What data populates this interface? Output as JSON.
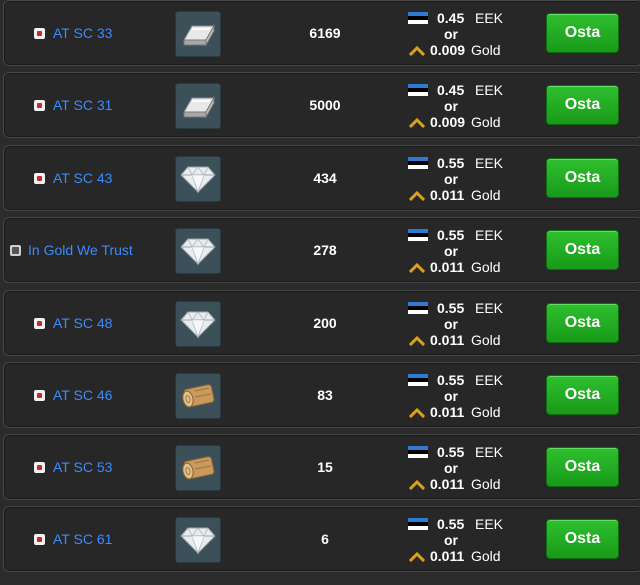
{
  "colors": {
    "link": "#3b8bff",
    "buy_button": "#22aa22",
    "row_bg": "#262726"
  },
  "rows": [
    {
      "seller": "AT SC 33",
      "seller_icon": "flag-icon",
      "item_icon": "silver-bar-icon",
      "quantity": "6169",
      "price_eek": "0.45",
      "currency": "EEK",
      "or_text": "or",
      "price_gold": "0.009",
      "gold_label": "Gold",
      "button": "Osta"
    },
    {
      "seller": "AT SC 31",
      "seller_icon": "flag-icon",
      "item_icon": "silver-bar-icon",
      "quantity": "5000",
      "price_eek": "0.45",
      "currency": "EEK",
      "or_text": "or",
      "price_gold": "0.009",
      "gold_label": "Gold",
      "button": "Osta"
    },
    {
      "seller": "AT SC 43",
      "seller_icon": "flag-icon",
      "item_icon": "diamond-icon",
      "quantity": "434",
      "price_eek": "0.55",
      "currency": "EEK",
      "or_text": "or",
      "price_gold": "0.011",
      "gold_label": "Gold",
      "button": "Osta"
    },
    {
      "seller": "In Gold We Trust",
      "seller_icon": "avatar-icon",
      "item_icon": "diamond-icon",
      "quantity": "278",
      "price_eek": "0.55",
      "currency": "EEK",
      "or_text": "or",
      "price_gold": "0.011",
      "gold_label": "Gold",
      "button": "Osta"
    },
    {
      "seller": "AT SC 48",
      "seller_icon": "flag-icon",
      "item_icon": "diamond-icon",
      "quantity": "200",
      "price_eek": "0.55",
      "currency": "EEK",
      "or_text": "or",
      "price_gold": "0.011",
      "gold_label": "Gold",
      "button": "Osta"
    },
    {
      "seller": "AT SC 46",
      "seller_icon": "flag-icon",
      "item_icon": "wood-log-icon",
      "quantity": "83",
      "price_eek": "0.55",
      "currency": "EEK",
      "or_text": "or",
      "price_gold": "0.011",
      "gold_label": "Gold",
      "button": "Osta"
    },
    {
      "seller": "AT SC 53",
      "seller_icon": "flag-icon",
      "item_icon": "wood-log-icon",
      "quantity": "15",
      "price_eek": "0.55",
      "currency": "EEK",
      "or_text": "or",
      "price_gold": "0.011",
      "gold_label": "Gold",
      "button": "Osta"
    },
    {
      "seller": "AT SC 61",
      "seller_icon": "flag-icon",
      "item_icon": "diamond-icon",
      "quantity": "6",
      "price_eek": "0.55",
      "currency": "EEK",
      "or_text": "or",
      "price_gold": "0.011",
      "gold_label": "Gold",
      "button": "Osta"
    }
  ]
}
